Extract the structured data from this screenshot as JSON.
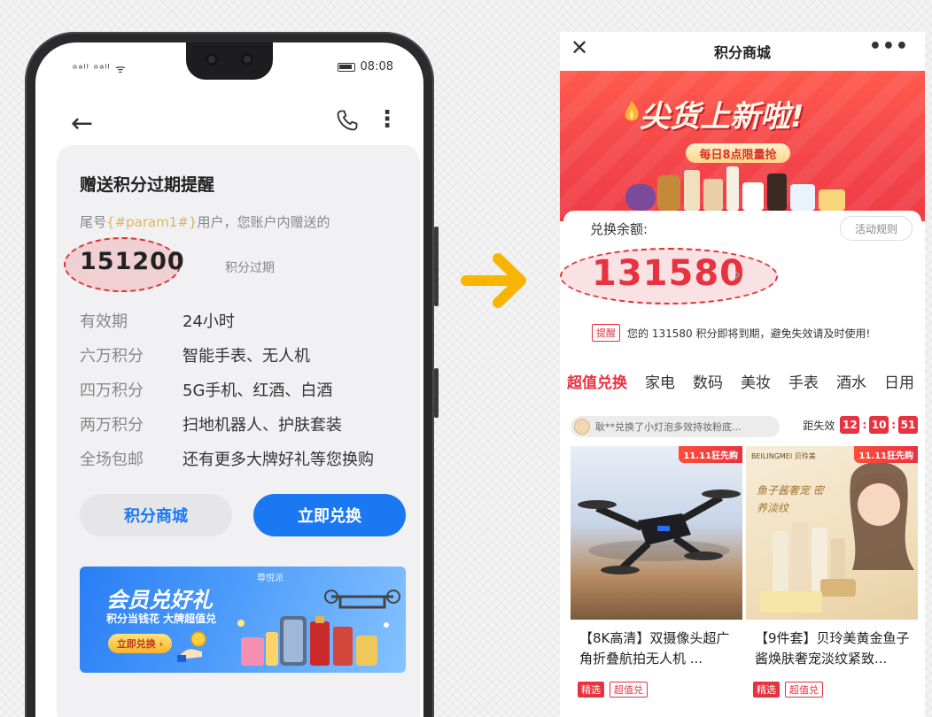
{
  "left_phone": {
    "status": {
      "signal": "ᵒᵃˡˡ ᵒᵃˡˡ ᯤ",
      "time": "08:08"
    },
    "message": {
      "title": "赠送积分过期提醒",
      "sub_prefix": "尾号",
      "param": "{#param1#}",
      "sub_suffix": "用户，您账户内赠送的",
      "points": "151200",
      "expire_text": "积分过期",
      "rows": [
        {
          "key": "有效期",
          "value": "24小时"
        },
        {
          "key": "六万积分",
          "value": "智能手表、无人机"
        },
        {
          "key": "四万积分",
          "value": "5G手机、红酒、白酒"
        },
        {
          "key": "两万积分",
          "value": "扫地机器人、护肤套装"
        },
        {
          "key": "全场包邮",
          "value": "还有更多大牌好礼等您换购"
        }
      ],
      "btn_mall": "积分商城",
      "btn_redeem": "立即兑换"
    },
    "banner": {
      "brand": "尊悦派",
      "title": "会员兑好礼",
      "sub": "积分当钱花 大牌超值兑",
      "btn": "立即兑换 ›"
    }
  },
  "right_screen": {
    "header": {
      "close": "✕",
      "title": "积分商城",
      "more": "•••"
    },
    "hero": {
      "title": "尖货上新啦!",
      "tag": "每日8点限量抢"
    },
    "balance": {
      "label": "兑换余额:",
      "rule_btn": "活动规则",
      "amount": "131580",
      "chevron": "›",
      "notice_tag": "提醒",
      "notice_text": "您的 131580 积分即将到期，避免失效请及时使用!"
    },
    "categories": [
      "超值兑换",
      "家电",
      "数码",
      "美妆",
      "手表",
      "酒水",
      "日用"
    ],
    "ticker": "耿**兑换了小灯泡多效持妆粉底...",
    "countdown": {
      "label": "距失效",
      "h": "12",
      "m": "10",
      "s": "51",
      "sep": ":"
    },
    "products": [
      {
        "badge": "11.11狂先购",
        "name": "【8K高清】双摄像头超广角折叠航拍无人机 ...",
        "tag1": "精选",
        "tag2": "超值兑"
      },
      {
        "badge": "11.11狂先购",
        "brand": "BEILINGMEI 贝玲美",
        "slogan": "鱼子酱奢宠 密养淡纹",
        "name": "【9件套】贝玲美黄金鱼子酱焕肤奢宠淡纹紧致...",
        "tag1": "精选",
        "tag2": "超值兑"
      }
    ]
  },
  "colors": {
    "blue": "#1a78f2",
    "red": "#e8323f",
    "arrow": "#f7b500"
  }
}
